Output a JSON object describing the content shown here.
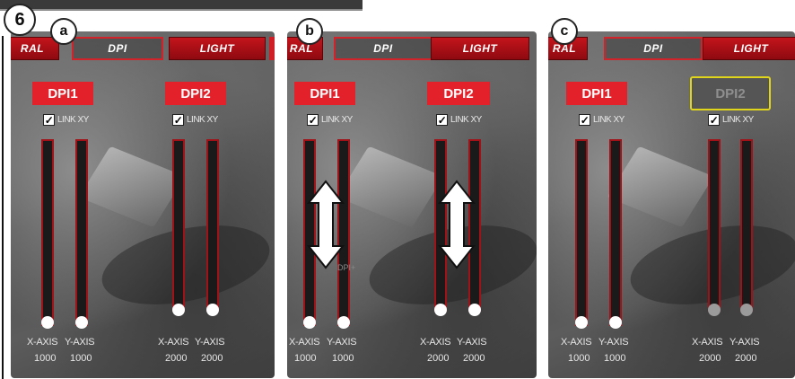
{
  "step": {
    "number": "6"
  },
  "panels": {
    "a": {
      "letter": "a",
      "tabs": {
        "left_partial": "RAL",
        "dpi": "DPI",
        "light": "LIGHT"
      },
      "dpi1": {
        "label": "DPI1",
        "link": "LINK XY",
        "x_label": "X-AXIS",
        "y_label": "Y-AXIS",
        "x_value": "1000",
        "y_value": "1000",
        "x_level": 0.0,
        "y_level": 0.0
      },
      "dpi2": {
        "label": "DPI2",
        "link": "LINK XY",
        "x_label": "X-AXIS",
        "y_label": "Y-AXIS",
        "x_value": "2000",
        "y_value": "2000",
        "x_level": 0.1,
        "y_level": 0.1
      }
    },
    "b": {
      "letter": "b",
      "tabs": {
        "left_partial": "RAL",
        "dpi": "DPI",
        "light": "LIGHT"
      },
      "dpi1": {
        "label": "DPI1",
        "link": "LINK XY",
        "x_label": "X-AXIS",
        "y_label": "Y-AXIS",
        "x_value": "1000",
        "y_value": "1000"
      },
      "dpi2": {
        "label": "DPI2",
        "link": "LINK XY",
        "x_label": "X-AXIS",
        "y_label": "Y-AXIS",
        "x_value": "2000",
        "y_value": "2000"
      },
      "overlay_text": "DPI+"
    },
    "c": {
      "letter": "c",
      "tabs": {
        "left_partial": "RAL",
        "dpi": "DPI",
        "light": "LIGHT"
      },
      "dpi1": {
        "label": "DPI1",
        "link": "LINK XY",
        "x_label": "X-AXIS",
        "y_label": "Y-AXIS",
        "x_value": "1000",
        "y_value": "1000"
      },
      "dpi2": {
        "label": "DPI2",
        "link": "LINK XY",
        "x_label": "X-AXIS",
        "y_label": "Y-AXIS",
        "x_value": "2000",
        "y_value": "2000"
      }
    }
  },
  "colors": {
    "accent_red": "#e3212b",
    "highlight_yellow": "#e0d51a",
    "knob_white": "#ffffff",
    "knob_disabled": "#9b9b9b"
  },
  "icons": {
    "checkbox": "check-icon",
    "resize": "vertical-double-arrow-icon"
  }
}
